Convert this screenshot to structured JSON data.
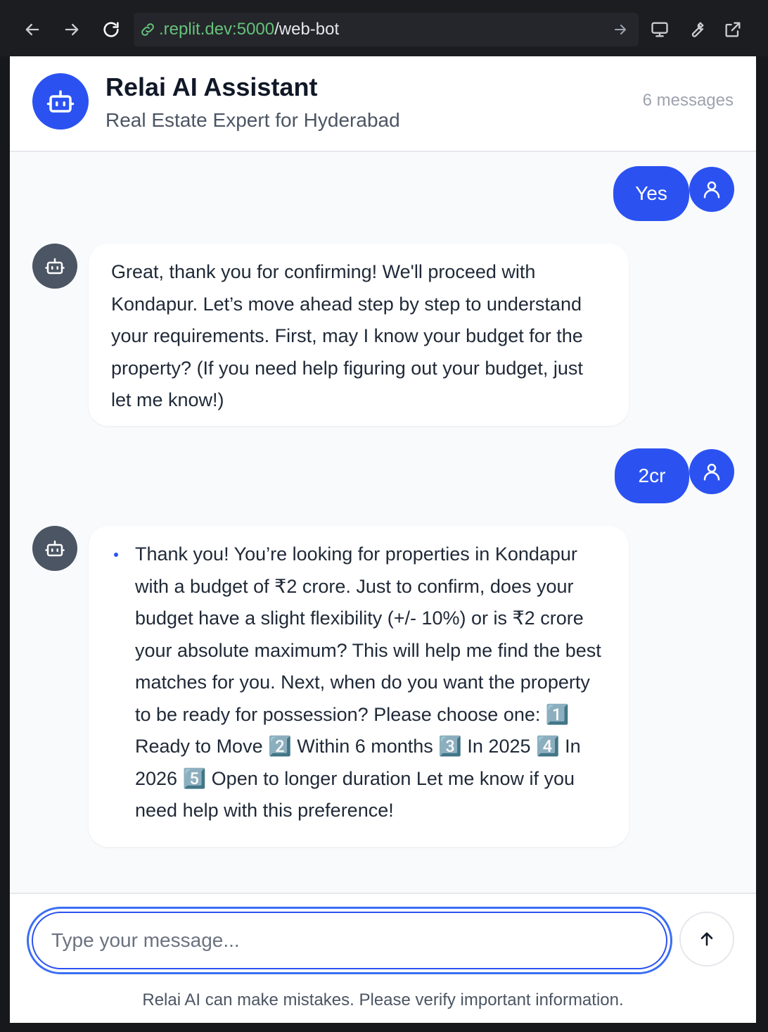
{
  "browser": {
    "url_host": ".replit.dev:5000",
    "url_path": "/web-bot"
  },
  "header": {
    "title": "Relai AI Assistant",
    "subtitle": "Real Estate Expert for Hyderabad",
    "message_count": "6 messages"
  },
  "messages": [
    {
      "role": "user",
      "text": "Yes"
    },
    {
      "role": "bot",
      "text": "Great, thank you for confirming! We'll proceed with Kondapur. Let’s move ahead step by step to understand your requirements. First, may I know your budget for the property? (If you need help figuring out your budget, just let me know!)"
    },
    {
      "role": "user",
      "text": "2cr"
    },
    {
      "role": "bot",
      "bullets": [
        "Thank you! You’re looking for properties in Kondapur with a budget of ₹2 crore. Just to confirm, does your budget have a slight flexibility (+/- 10%) or is ₹2 crore your absolute maximum? This will help me find the best matches for you. Next, when do you want the property to be ready for possession? Please choose one: 1️⃣ Ready to Move 2️⃣ Within 6 months 3️⃣ In 2025 4️⃣ In 2026 5️⃣ Open to longer duration Let me know if you need help with this preference!"
      ]
    }
  ],
  "composer": {
    "placeholder": "Type your message...",
    "value": "",
    "disclaimer": "Relai AI can make mistakes. Please verify important information."
  },
  "icons": {
    "back": "arrow-left-icon",
    "forward": "arrow-right-icon",
    "reload": "reload-icon",
    "link": "link-icon",
    "go": "arrow-right-icon",
    "devtools": "monitor-icon",
    "tools": "wrench-icon",
    "open-external": "external-link-icon",
    "bot": "bot-icon",
    "user": "user-icon",
    "send": "arrow-up-icon"
  },
  "colors": {
    "accent": "#2b52f0",
    "bot_avatar": "#4b5563",
    "app_background": "#f8fafc",
    "browser_chrome": "#1c1d21",
    "url_host": "#66c27a"
  }
}
